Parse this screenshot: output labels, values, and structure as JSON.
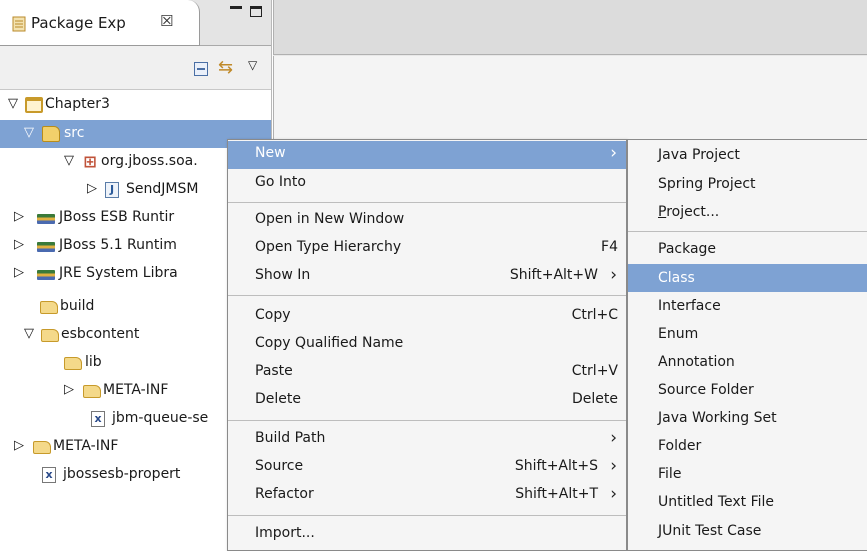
{
  "explorer": {
    "tab_label": "Package Exp",
    "tab_close": "☒",
    "tree": [
      {
        "label": "Chapter3",
        "arrow": "▽",
        "icon": "project-icon"
      },
      {
        "label": "src",
        "arrow": "▽",
        "icon": "source-folder-icon"
      },
      {
        "label": "org.jboss.soa.",
        "arrow": "▽",
        "icon": "package-icon"
      },
      {
        "label": "SendJMSM",
        "arrow": "▷",
        "icon": "java-file-icon"
      },
      {
        "label": "JBoss ESB Runtir",
        "arrow": "▷",
        "icon": "library-icon"
      },
      {
        "label": "JBoss 5.1 Runtim",
        "arrow": "▷",
        "icon": "library-icon"
      },
      {
        "label": "JRE System Libra",
        "arrow": "▷",
        "icon": "library-icon"
      },
      {
        "label": "build",
        "arrow": "",
        "icon": "folder-icon"
      },
      {
        "label": "esbcontent",
        "arrow": "▽",
        "icon": "folder-icon"
      },
      {
        "label": "lib",
        "arrow": "",
        "icon": "folder-icon"
      },
      {
        "label": "META-INF",
        "arrow": "▷",
        "icon": "folder-icon"
      },
      {
        "label": "jbm-queue-se",
        "arrow": "",
        "icon": "xml-file-icon"
      },
      {
        "label": "META-INF",
        "arrow": "▷",
        "icon": "folder-icon"
      },
      {
        "label": "jbossesb-propert",
        "arrow": "",
        "icon": "xml-file-icon"
      }
    ]
  },
  "context_menu": {
    "new": "New",
    "go_into": "Go Into",
    "open_new_window": "Open in New Window",
    "open_type_hierarchy": "Open Type Hierarchy",
    "open_type_hierarchy_sc": "F4",
    "show_in": "Show In",
    "show_in_sc": "Shift+Alt+W",
    "copy": "Copy",
    "copy_sc": "Ctrl+C",
    "copy_qualified": "Copy Qualified Name",
    "paste": "Paste",
    "paste_sc": "Ctrl+V",
    "delete": "Delete",
    "delete_sc": "Delete",
    "build_path": "Build Path",
    "source": "Source",
    "source_sc": "Shift+Alt+S",
    "refactor": "Refactor",
    "refactor_sc": "Shift+Alt+T",
    "import": "Import..."
  },
  "submenu": {
    "java_project": "Java Project",
    "spring_project": "Spring Project",
    "project_p": "P",
    "project_rest": "roject...",
    "package": "Package",
    "class": "Class",
    "interface": "Interface",
    "enum": "Enum",
    "annotation": "Annotation",
    "source_folder": "Source Folder",
    "java_working_set": "Java Working Set",
    "folder": "Folder",
    "file": "File",
    "untitled_text_file": "Untitled Text File",
    "junit_test_case": "JUnit Test Case"
  },
  "colors": {
    "selection": "#7ea2d3",
    "menu_bg": "#f5f5f5"
  }
}
